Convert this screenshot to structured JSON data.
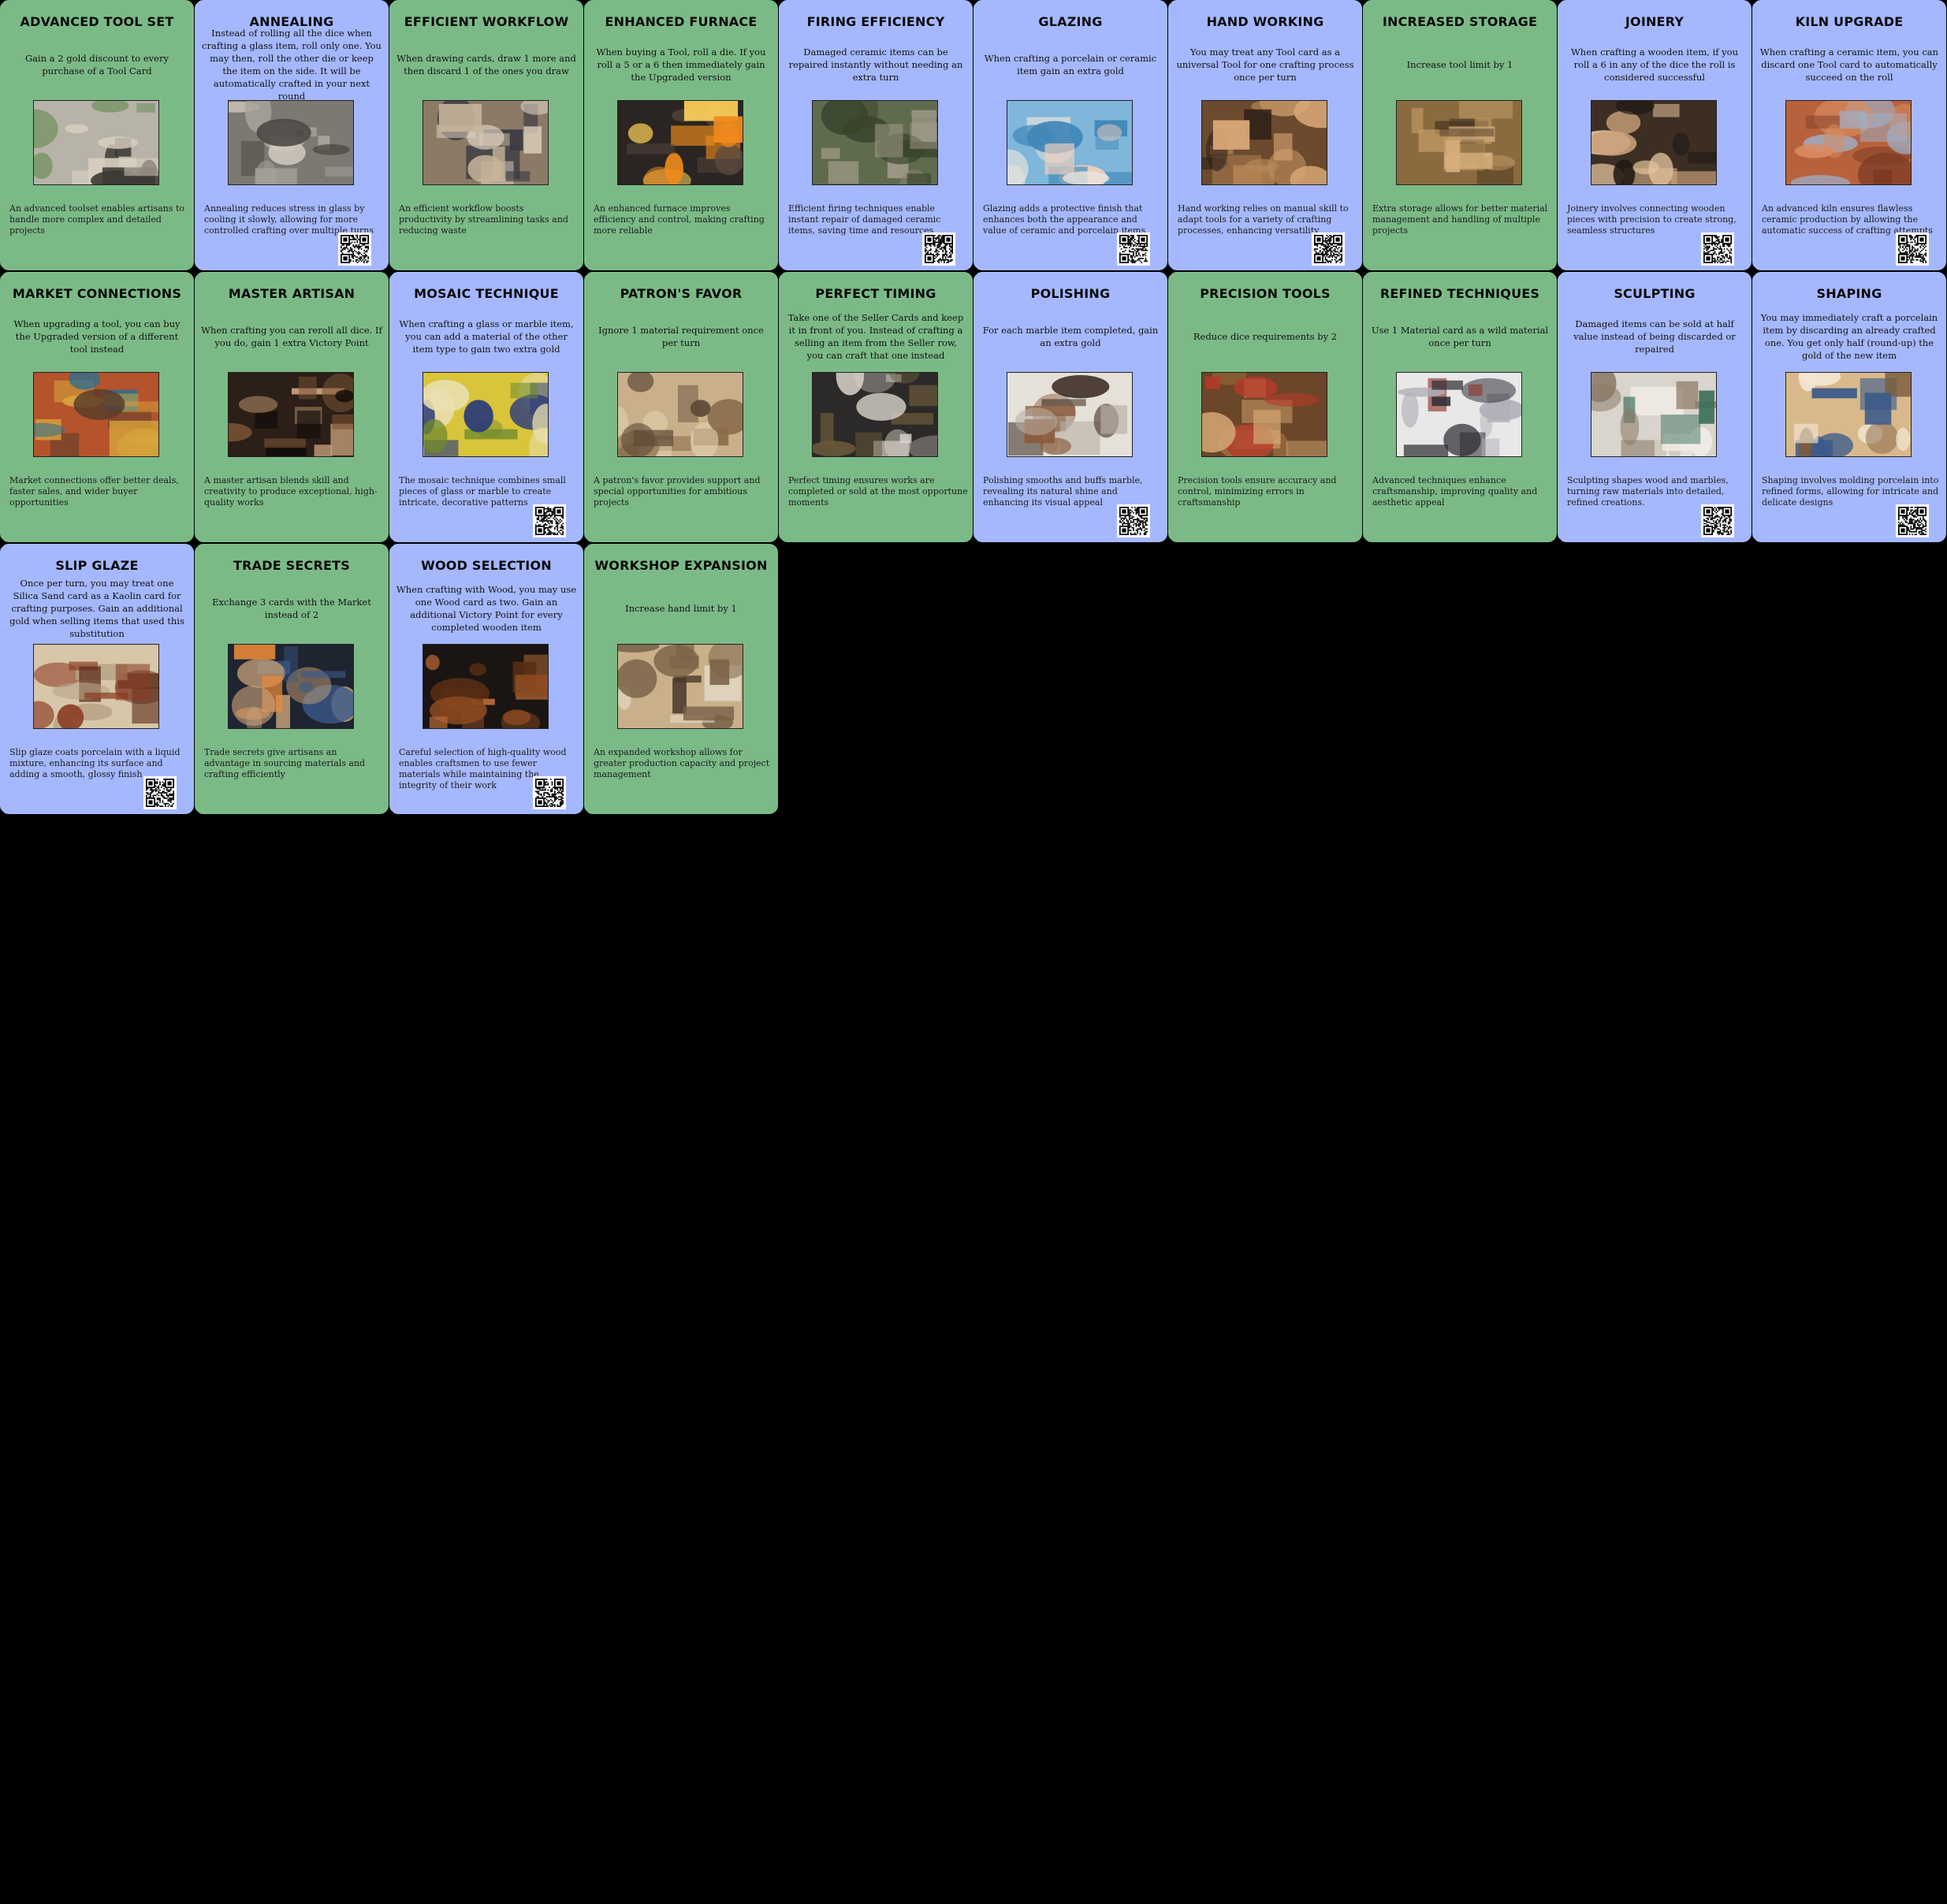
{
  "colors": {
    "tool_card": "#7bba87",
    "material_card": "#a5b8ff",
    "background": "#000000"
  },
  "cards": [
    {
      "title": "ADVANCED TOOL SET",
      "rule": "Gain a 2 gold discount to every purchase of a Tool Card",
      "flavor": "An advanced toolset enables artisans to handle more complex and detailed projects",
      "color": "green",
      "qr": false,
      "art": "carving-tools-photo",
      "palette": [
        "#b7b3a8",
        "#6b8f5a",
        "#3d3a35",
        "#d7cfbf"
      ]
    },
    {
      "title": "ANNEALING",
      "rule": "Instead of rolling all the dice when crafting a glass item, roll only one. You may then, roll the other die or keep the item on the side. It will be automatically crafted in your next round",
      "flavor": "Annealing reduces stress in glass by cooling it slowly, allowing for more controlled crafting over multiple turns",
      "color": "blue",
      "qr": true,
      "art": "glass-annealing-photo",
      "palette": [
        "#7c7872",
        "#a8a49c",
        "#4b4843",
        "#cfc9bd"
      ]
    },
    {
      "title": "EFFICIENT WORKFLOW",
      "rule": "When drawing cards, draw 1 more and then discard 1 of the ones you draw",
      "flavor": "An efficient workflow boosts productivity by streamlining tasks and reducing waste",
      "color": "green",
      "qr": false,
      "art": "workshop-craftsman-photo",
      "palette": [
        "#8b7a66",
        "#c7b59b",
        "#3a3a44",
        "#e0d4c2"
      ]
    },
    {
      "title": "ENHANCED FURNACE",
      "rule": "When buying a Tool, roll a die. If you roll a 5 or a 6 then immediately gain the Upgraded version",
      "flavor": "An enhanced furnace improves efficiency and control, making crafting more reliable",
      "color": "green",
      "qr": false,
      "art": "glowing-furnace-photo",
      "palette": [
        "#2a2522",
        "#f08a1c",
        "#5a4a3e",
        "#ffd05a"
      ]
    },
    {
      "title": "FIRING EFFICIENCY",
      "rule": "Damaged ceramic items can be repaired instantly without needing an extra turn",
      "flavor": "Efficient firing techniques enable instant repair of damaged ceramic items, saving time and resources",
      "color": "blue",
      "qr": true,
      "art": "wood-kiln-photo",
      "palette": [
        "#5e6b4c",
        "#8c8476",
        "#39432d",
        "#a79f8f"
      ]
    },
    {
      "title": "GLAZING",
      "rule": "When crafting a porcelain or ceramic item gain an extra gold",
      "flavor": "Glazing adds a protective finish that enhances both the appearance and value of ceramic and porcelain items",
      "color": "blue",
      "qr": true,
      "art": "glaze-pouring-photo",
      "palette": [
        "#7fb6d9",
        "#e9e4dc",
        "#3f87b8",
        "#f2d0bd"
      ]
    },
    {
      "title": "HAND WORKING",
      "rule": "You may treat any Tool card as a universal Tool for one crafting process once per turn",
      "flavor": "Hand working relies on manual skill to adapt tools for a variety of crafting processes, enhancing versatility",
      "color": "blue",
      "qr": true,
      "art": "hands-carving-wood-photo",
      "palette": [
        "#6b4a2e",
        "#b88858",
        "#2d2119",
        "#d9a877"
      ]
    },
    {
      "title": "INCREASED STORAGE",
      "rule": "Increase tool limit by 1",
      "flavor": "Extra storage allows for better material management and handling of multiple projects",
      "color": "green",
      "qr": false,
      "art": "stacked-baskets-photo",
      "palette": [
        "#8a6a3f",
        "#c9a06a",
        "#4a3620",
        "#e2c08e"
      ]
    },
    {
      "title": "JOINERY",
      "rule": "When crafting a wooden item, if you roll a 6 in any of the dice the roll is considered successful",
      "flavor": "Joinery involves connecting wooden pieces with precision to create strong, seamless structures",
      "color": "blue",
      "qr": true,
      "art": "dovetail-joint-photo",
      "palette": [
        "#3d2e24",
        "#c9a27a",
        "#1f1814",
        "#e3c29d"
      ]
    },
    {
      "title": "KILN UPGRADE",
      "rule": "When crafting a ceramic item, you can discard one Tool card to automatically succeed on the roll",
      "flavor": "An advanced kiln ensures flawless ceramic production by allowing the automatic success of crafting attempts",
      "color": "blue",
      "qr": true,
      "art": "brick-kiln-photo",
      "palette": [
        "#b8623d",
        "#9fb0c8",
        "#7c3b24",
        "#d98c62"
      ]
    },
    {
      "title": "MARKET CONNECTIONS",
      "rule": "When upgrading a tool, you can buy the Upgraded version of a different tool instead",
      "flavor": "Market connections offer better deals, faster sales, and wider buyer opportunities",
      "color": "green",
      "qr": false,
      "art": "market-stall-photo",
      "palette": [
        "#b5532c",
        "#2f6f8f",
        "#d8a53c",
        "#5a3d2a"
      ]
    },
    {
      "title": "MASTER ARTISAN",
      "rule": "When crafting you can reroll all dice. If you do, gain 1 extra Victory Point",
      "flavor": "A master artisan blends skill and creativity to produce exceptional, high-quality works",
      "color": "green",
      "qr": false,
      "art": "artisan-at-work-photo",
      "palette": [
        "#2b1f17",
        "#7a5234",
        "#120d0a",
        "#c8a07a"
      ]
    },
    {
      "title": "MOSAIC TECHNIQUE",
      "rule": "When crafting a glass or marble item, you can add a material of the other item type to gain two extra gold",
      "flavor": "The mosaic technique combines small pieces of glass or marble to create intricate, decorative patterns",
      "color": "blue",
      "qr": true,
      "art": "mosaic-flower-photo",
      "palette": [
        "#d9c43a",
        "#2a3b7a",
        "#e8e0b0",
        "#6f8a2e"
      ]
    },
    {
      "title": "PATRON'S FAVOR",
      "rule": "Ignore 1 material requirement once per turn",
      "flavor": "A patron's favor provides support and special opportunities for ambitious projects",
      "color": "green",
      "qr": false,
      "art": "roman-mosaic-photo",
      "palette": [
        "#c9b08a",
        "#8a6a48",
        "#e3d2b0",
        "#5e4a36"
      ]
    },
    {
      "title": "PERFECT TIMING",
      "rule": "Take one of the Seller Cards and keep it in front of you. Instead of crafting a selling an item from the Seller row, you can craft that one instead",
      "flavor": "Perfect timing ensures works are completed or sold at the most opportune moments",
      "color": "green",
      "qr": false,
      "art": "clock-gears-photo",
      "palette": [
        "#2c2a28",
        "#a8a49e",
        "#6b5a3c",
        "#d8d2c8"
      ]
    },
    {
      "title": "POLISHING",
      "rule": "For each marble item completed, gain an extra gold",
      "flavor": "Polishing smooths and buffs marble, revealing its natural shine and enhancing its visual appeal",
      "color": "blue",
      "qr": true,
      "art": "polishing-marble-photo",
      "palette": [
        "#e6e1d8",
        "#8b5a3c",
        "#b8b0a4",
        "#3a2a20"
      ]
    },
    {
      "title": "PRECISION TOOLS",
      "rule": "Reduce dice requirements by 2",
      "flavor": "Precision tools ensure accuracy and control, minimizing errors in craftsmanship",
      "color": "green",
      "qr": false,
      "art": "precision-tools-photo",
      "palette": [
        "#6b4628",
        "#a0703f",
        "#b33a2a",
        "#d0a270"
      ]
    },
    {
      "title": "REFINED TECHNIQUES",
      "rule": "Use 1 Material card as a wild material once per turn",
      "flavor": "Advanced techniques enhance craftsmanship, improving quality and aesthetic appeal",
      "color": "green",
      "qr": false,
      "art": "glass-sculpture-photo",
      "palette": [
        "#e8e8e8",
        "#2c2c33",
        "#8a2a22",
        "#b0b0b8"
      ]
    },
    {
      "title": "SCULPTING",
      "rule": "Damaged items can be sold at half value instead of being discarded or repaired",
      "flavor": "Sculpting shapes wood and marbles, turning raw materials into detailed, refined creations.",
      "color": "blue",
      "qr": true,
      "art": "sculptor-photo",
      "palette": [
        "#d9d4cc",
        "#3b6e5a",
        "#8a7a66",
        "#f0ece6"
      ]
    },
    {
      "title": "SHAPING",
      "rule": "You may immediately craft a porcelain item by discarding an already crafted one. You get only half (round-up) the gold of the new item",
      "flavor": "Shaping involves molding porcelain into refined forms, allowing for intricate and delicate designs",
      "color": "blue",
      "qr": true,
      "art": "clay-shaping-photo",
      "palette": [
        "#d9b98c",
        "#f2e6d2",
        "#7a5c3e",
        "#3a5a8a"
      ]
    },
    {
      "title": "SLIP GLAZE",
      "rule": "Once per turn, you may treat one Silica Sand card as a Kaolin card for crafting purposes. Gain an additional gold when selling items that used this substitution",
      "flavor": "Slip glaze coats porcelain with a liquid mixture, enhancing its surface and adding a smooth, glossy finish",
      "color": "blue",
      "qr": true,
      "art": "slip-glaze-bowl-photo",
      "palette": [
        "#d8c6a8",
        "#8a3a22",
        "#b8a488",
        "#5a2a18"
      ]
    },
    {
      "title": "TRADE SECRETS",
      "rule": "Exchange 3 cards with the Market instead of 2",
      "flavor": "Trade secrets give artisans an advantage in sourcing materials and crafting efficiently",
      "color": "green",
      "qr": false,
      "art": "glassblowers-photo",
      "palette": [
        "#1e2430",
        "#3a5a8a",
        "#c9a27a",
        "#e8893a"
      ]
    },
    {
      "title": "WOOD SELECTION",
      "rule": "When crafting with Wood, you may use one Wood card as two. Gain an additional Victory Point for every completed wooden item",
      "flavor": "Careful selection of high-quality wood enables craftsmen to use fewer materials while maintaining the integrity of their work",
      "color": "blue",
      "qr": true,
      "art": "wood-panels-photo",
      "palette": [
        "#1a1512",
        "#8a4a22",
        "#b86a36",
        "#5a2e14"
      ]
    },
    {
      "title": "WORKSHOP EXPANSION",
      "rule": "Increase hand limit by 1",
      "flavor": "An expanded workshop allows for greater production capacity and project management",
      "color": "green",
      "qr": false,
      "art": "workshop-room-photo",
      "palette": [
        "#c9b08a",
        "#e6dccb",
        "#7a6248",
        "#4a3a2a"
      ]
    }
  ]
}
